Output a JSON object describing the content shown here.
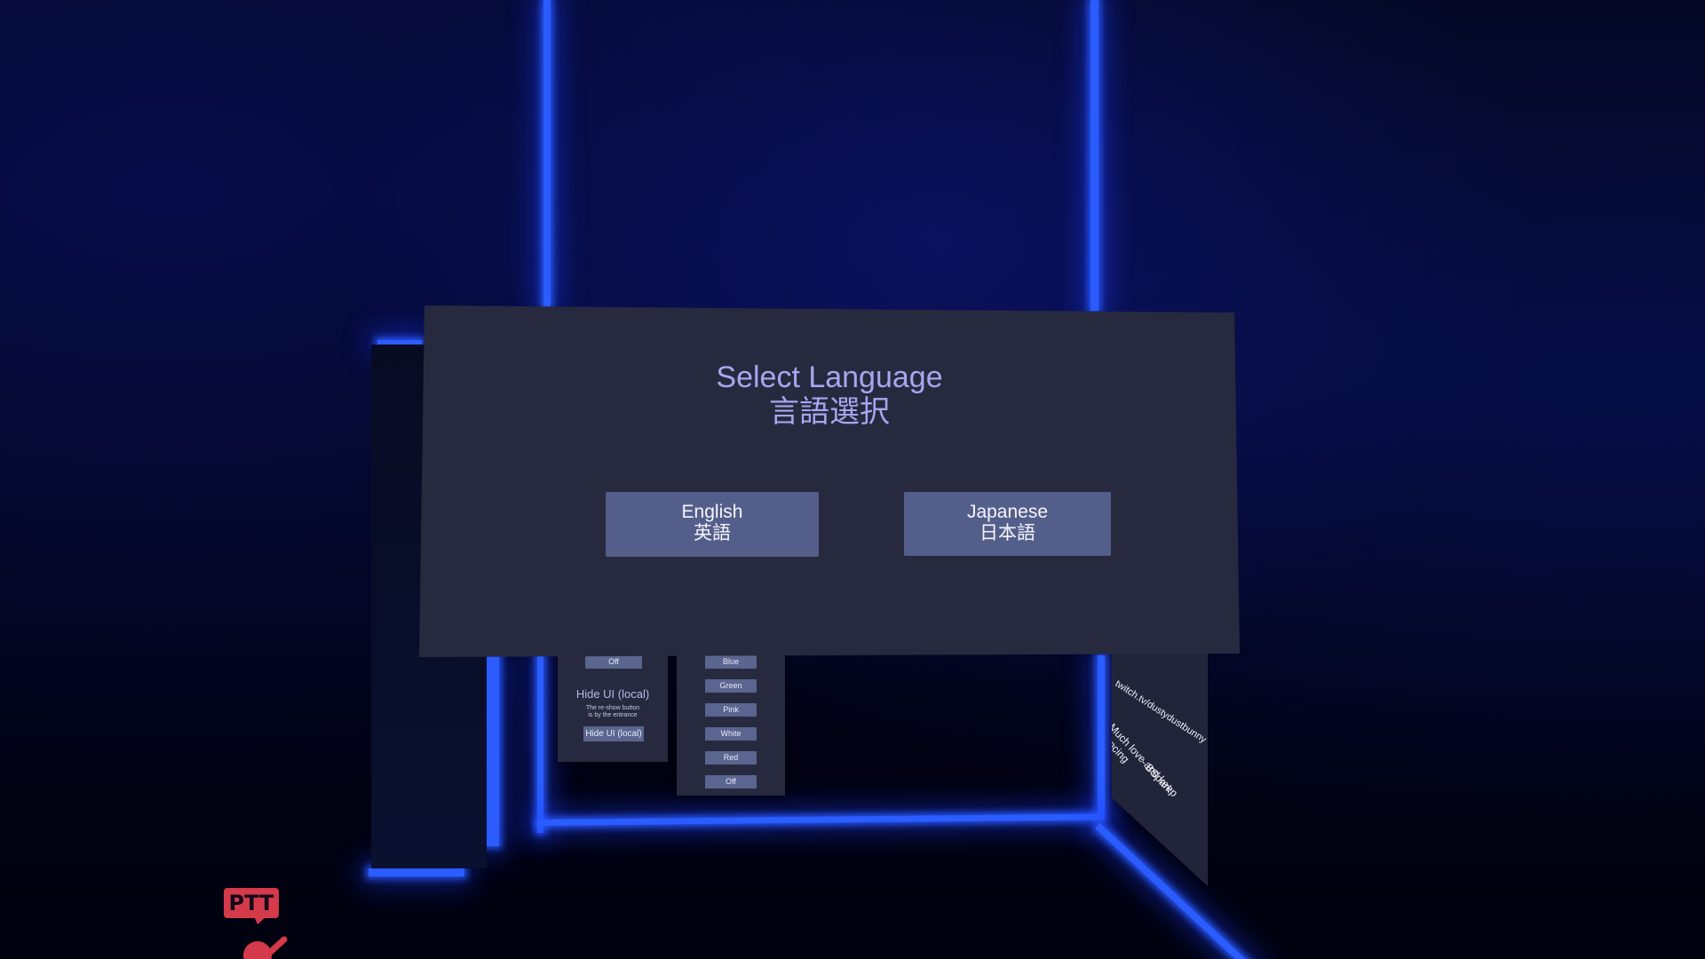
{
  "dialog": {
    "title": "Select Language",
    "subtitle": "言語選択",
    "buttons": [
      {
        "label": "English",
        "sublabel": "英語"
      },
      {
        "label": "Japanese",
        "sublabel": "日本語"
      }
    ]
  },
  "left_panel": {
    "toggle_value": "Off",
    "hide_ui_title": "Hide UI (local)",
    "hide_ui_note_line1": "The re-show button",
    "hide_ui_note_line2": "is by the entrance",
    "hide_ui_button": "Hide UI (local)"
  },
  "color_panel": {
    "options": [
      "Blue",
      "Green",
      "Pink",
      "White",
      "Red",
      "Off"
    ]
  },
  "right_sign": {
    "line1": "twitch.tv/dustydustbunny",
    "line2": "Much love and keep dancing",
    "line3": "- BSpark"
  },
  "overlay": {
    "ptt_label": "PTT"
  },
  "colors": {
    "neon": "#2a5cff",
    "dialog_bg": "#272a3e",
    "title_text": "#a8a6f0",
    "button_bg": "#545e8a",
    "ptt_badge": "#d43a4a"
  }
}
